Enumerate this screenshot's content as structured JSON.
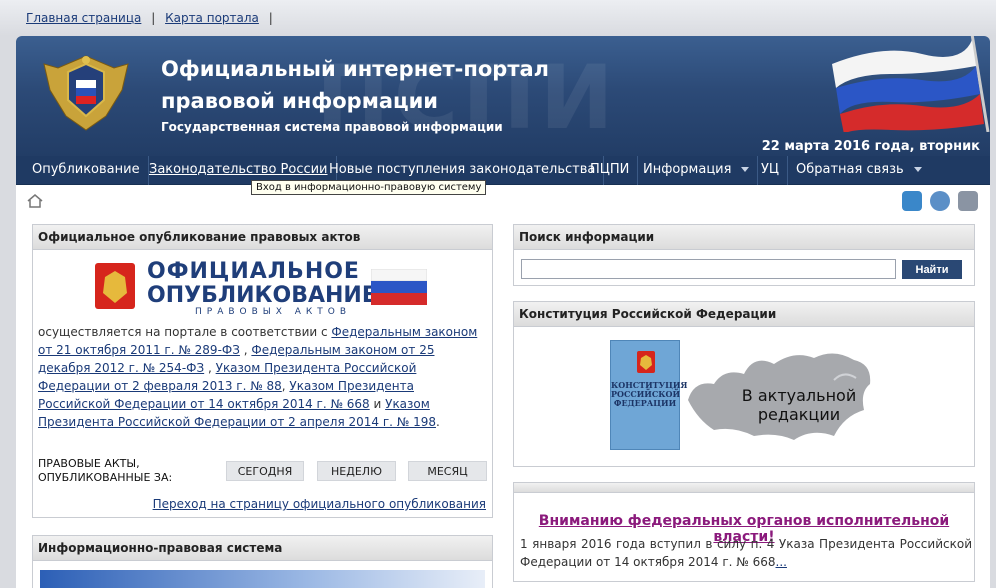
{
  "topbar": {
    "home": "Главная страница",
    "sitemap": "Карта портала",
    "sep": "|"
  },
  "banner": {
    "title": "Официальный интернет-портал правовой информации",
    "subtitle": "Государственная система правовой информации",
    "date": "22 марта 2016 года, вторник",
    "watermark": "ПСПИ"
  },
  "nav": [
    {
      "label": "Опубликование"
    },
    {
      "label": "Законодательство России"
    },
    {
      "label": "Новые поступления законодательства"
    },
    {
      "label": "ПЦПИ"
    },
    {
      "label": "Информация"
    },
    {
      "label": "УЦ"
    },
    {
      "label": "Обратная связь"
    }
  ],
  "tooltip": "Вход в информационно-правовую систему",
  "official": {
    "header": "Официальное опубликование правовых актов",
    "logo_l1": "ОФИЦИАЛЬНОЕ",
    "logo_l2": "ОПУБЛИКОВАНИЕ",
    "logo_l3": "ПРАВОВЫХ АКТОВ",
    "intro": "осуществляется на портале в соответствии с ",
    "link1": "Федеральным  законом от 21 октября 2011 г. № 289-ФЗ",
    "sep1": " , ",
    "link2": "Федеральным законом от 25 декабря 2012 г. № 254-ФЗ",
    "sep2": " , ",
    "link3": "Указом Президента Российской Федерации от 2 февраля 2013 г. № 88",
    "sep3": ", ",
    "link4": "Указом Президента Российской Федерации от 14 октября 2014 г. № 668",
    "sep4": " и ",
    "link5": "Указом Президента Российской Федерации от 2 апреля 2014 г. № 198",
    "end": ".",
    "acts_label_1": "ПРАВОВЫЕ АКТЫ,",
    "acts_label_2": "ОПУБЛИКОВАННЫЕ ЗА:",
    "btn_today": "СЕГОДНЯ",
    "btn_week": "НЕДЕЛЮ",
    "btn_month": "МЕСЯЦ",
    "page_link": "Переход на страницу официального опубликования"
  },
  "system": {
    "header": "Информационно-правовая система"
  },
  "search": {
    "header": "Поиск информации",
    "button": "Найти",
    "value": ""
  },
  "constitution": {
    "header": "Конституция Российской Федерации",
    "book_title": "КОНСТИТУЦИЯ РОССИЙСКОЙ ФЕДЕРАЦИИ",
    "line1": "В актуальной",
    "line2": "редакции"
  },
  "notice": {
    "title": "Вниманию федеральных органов исполнительной власти!",
    "text": "1 января 2016 года вступил в силу п. 4 Указа Президента Российской Федерации от 14 октября 2014 г. № 668",
    "more": "..."
  },
  "colors": {
    "nav_bg": "#1f3a63",
    "banner": "#2c4a77",
    "notice_title": "#8b1a7c",
    "search_btn": "#2a4874"
  }
}
